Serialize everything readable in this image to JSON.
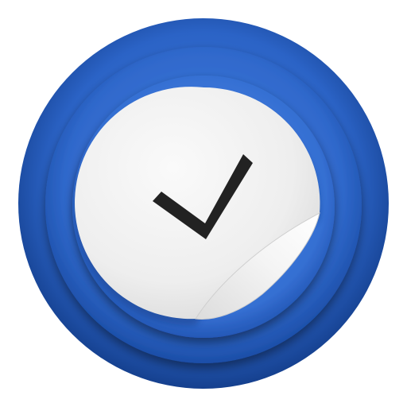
{
  "icon": {
    "name": "checkmark-sticker-app-icon",
    "colors": {
      "ring_outer": "#1f4fa3",
      "ring_mid": "#2a5fbd",
      "ring_inner": "#3a7ad6",
      "sticker_face": "#efefef",
      "sticker_shadow": "#c9c9c9",
      "curl_highlight": "#ffffff",
      "checkmark": "#222222"
    }
  }
}
